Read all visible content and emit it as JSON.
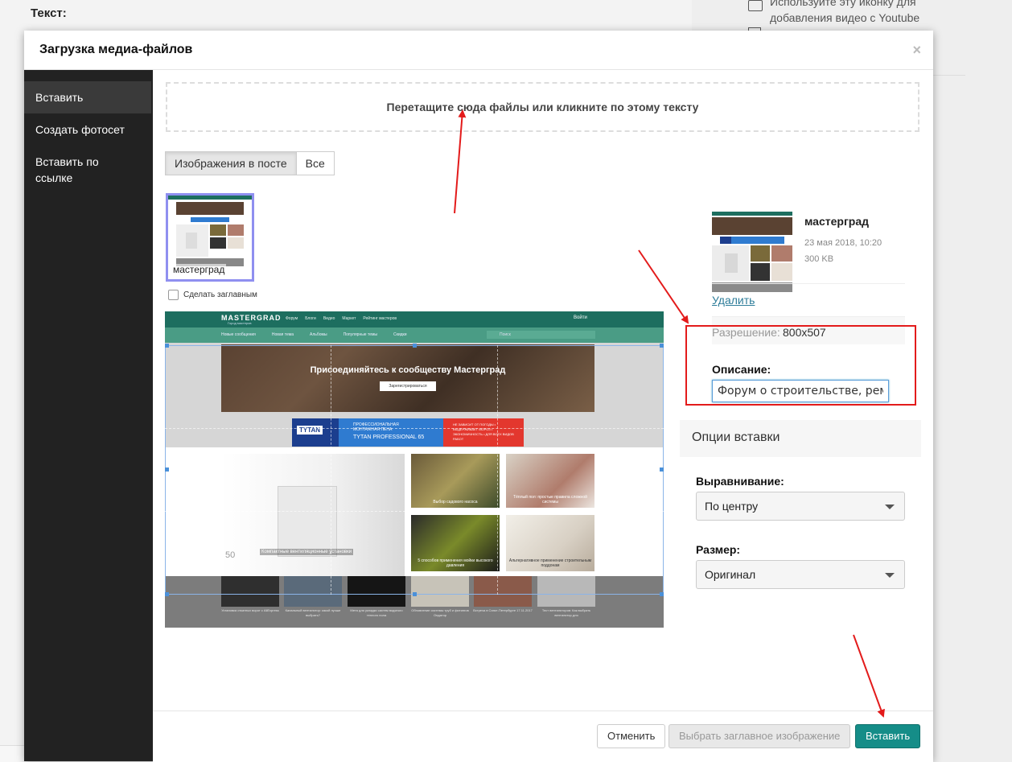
{
  "background": {
    "text_label": "Текст:",
    "youtube_hint": "Используйте эту иконку для добавления видео с Youtube"
  },
  "modal": {
    "title": "Загрузка медиа-файлов",
    "close_icon": "×"
  },
  "sidebar": {
    "items": [
      {
        "label": "Вставить",
        "active": true
      },
      {
        "label": "Создать фотосет",
        "active": false
      },
      {
        "label": "Вставить по ссылке",
        "active": false
      }
    ]
  },
  "dropzone": {
    "label": "Перетащите сюда файлы или кликните по этому тексту"
  },
  "filter_tabs": [
    {
      "label": "Изображения в посте",
      "active": true
    },
    {
      "label": "Все",
      "active": false
    }
  ],
  "thumbnail": {
    "name": "мастерград"
  },
  "make_cover": {
    "label": "Сделать заглавным",
    "checked": false
  },
  "preview": {
    "logo": "MASTERGRAD",
    "logo_sub": "Город мастеров",
    "nav": [
      "Форум",
      "Блоги",
      "Видео",
      "Маркет",
      "Рейтинг мастеров"
    ],
    "login": "Войти",
    "subnav": [
      "Новые сообщения",
      "Новая тема",
      "Альбомы",
      "Популярные темы",
      "Скидки"
    ],
    "search_placeholder": "Поиск",
    "banner_title": "Присоединяйтесь к сообществу Мастерград",
    "banner_button": "Зарегистрироваться",
    "ad_logo": "TYTAN",
    "ad_line1": "ПРОФЕССИОНАЛЬНАЯ",
    "ad_line2": "МОНТАЖНАЯ ПЕНА",
    "ad_line3": "TYTAN PROFESSIONAL 65",
    "ad_right": "НЕ ЗАВИСИТ ОТ ПОГОДЫ • ВЫДЕРЖИВАЕТ МОРОЗ • ЭКОНОМИЧНОСТЬ • ДЛЯ ВСЕХ ВИДОВ РАБОТ",
    "big_caption": "Компактные вентиляционные установки",
    "big_number": "50",
    "tiles": [
      {
        "caption": "Выбор садового насоса"
      },
      {
        "caption": "Тёплый пол: простые правила сложной системы"
      },
      {
        "caption": "5 способов применения мойки высокого давления"
      },
      {
        "caption": "Альтернативное применение строительным поддонам"
      }
    ],
    "videos": [
      "Установка откатных ворот с AliExpress",
      "Канальный вентилятор: какой лучше выбрать?",
      "Мета для укладки систем водяного теплого пола",
      "Обновление системы труб и фитингов Ондатор",
      "Встреча в Санкт-Петербурге 17.11.2017",
      "Тест вентиляторов: Как выбрать вентилятор для"
    ]
  },
  "details": {
    "name": "мастерград",
    "date": "23 мая 2018, 10:20",
    "size": "300 KB",
    "delete_label": "Удалить",
    "resolution_label": "Разрешение:",
    "resolution_value": "800x507",
    "description_label": "Описание:",
    "description_value": "Форум о строительстве, ремонте"
  },
  "insert_options": {
    "header": "Опции вставки",
    "align_label": "Выравнивание:",
    "align_value": "По центру",
    "size_label": "Размер:",
    "size_value": "Оригинал"
  },
  "footer": {
    "cancel": "Отменить",
    "choose_cover": "Выбрать заглавное изображение",
    "insert": "Вставить"
  },
  "colors": {
    "accent": "#158d88",
    "annotation": "#e31b1b",
    "sidebar": "#222222"
  }
}
